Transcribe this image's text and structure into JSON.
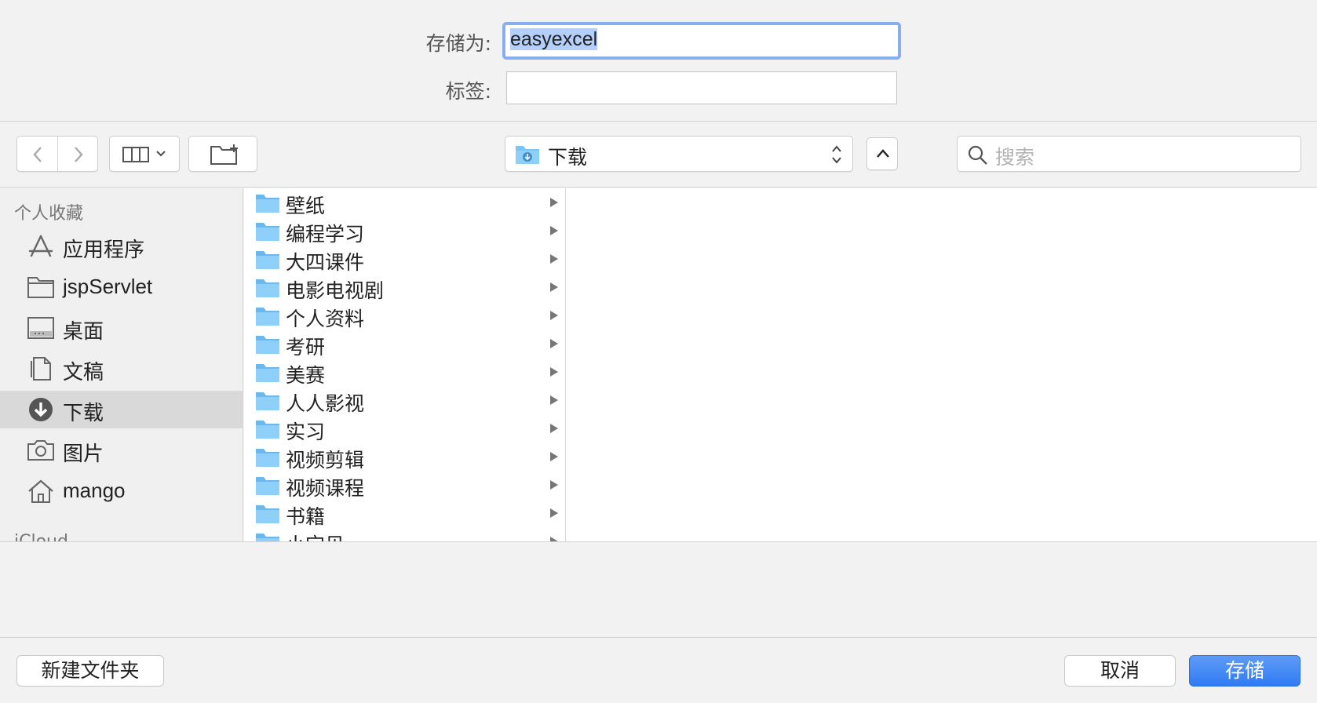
{
  "form": {
    "save_as_label": "存储为:",
    "save_as_value": "easyexcel",
    "tags_label": "标签:",
    "tags_value": ""
  },
  "toolbar": {
    "location": "下载",
    "search_placeholder": "搜索"
  },
  "sidebar": {
    "favorites_header": "个人收藏",
    "items": [
      {
        "label": "应用程序",
        "icon": "applications-icon"
      },
      {
        "label": "jspServlet",
        "icon": "folder-icon"
      },
      {
        "label": "桌面",
        "icon": "desktop-icon"
      },
      {
        "label": "文稿",
        "icon": "documents-icon"
      },
      {
        "label": "下载",
        "icon": "downloads-icon",
        "selected": true
      },
      {
        "label": "图片",
        "icon": "pictures-icon"
      },
      {
        "label": "mango",
        "icon": "home-icon"
      }
    ],
    "icloud_header": "iCloud"
  },
  "folders": [
    "壁纸",
    "编程学习",
    "大四课件",
    "电影电视剧",
    "个人资料",
    "考研",
    "美赛",
    "人人影视",
    "实习",
    "视频剪辑",
    "视频课程",
    "书籍",
    "小宝贝"
  ],
  "buttons": {
    "new_folder": "新建文件夹",
    "cancel": "取消",
    "save": "存储"
  },
  "colors": {
    "accent": "#2f7bf4",
    "folder": "#7cc4f5",
    "focus_ring": "#86aef0"
  }
}
